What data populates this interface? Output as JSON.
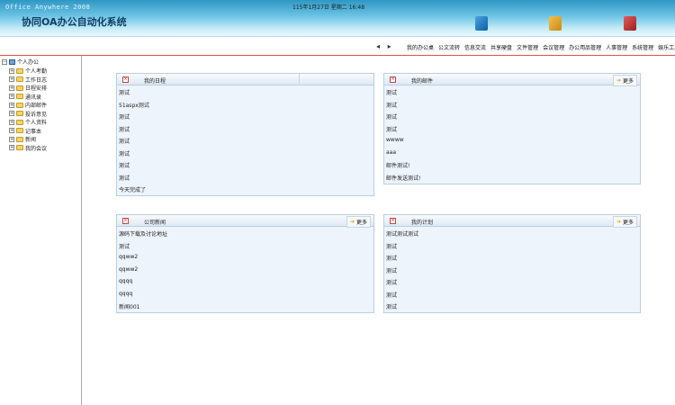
{
  "header": {
    "brand_en": "Office Anywhere 2008",
    "brand_cn": "协同OA办公自动化系统",
    "datetime": "115年1月27日 星期二 16:48"
  },
  "nav": {
    "arrow_left": "◂",
    "arrow_right": "▸",
    "items": [
      "我的办公桌",
      "公文流转",
      "信息交流",
      "共享硬盘",
      "文件管理",
      "会议管理",
      "办公用品管理",
      "人事管理",
      "系统管理",
      "娱乐工具"
    ]
  },
  "sidebar": {
    "root": "个人办公",
    "items": [
      "个人考勤",
      "工作日志",
      "日程安排",
      "通讯录",
      "内部邮件",
      "投诉意见",
      "个人资料",
      "记事本",
      "新闻",
      "我的会议"
    ]
  },
  "panels": {
    "schedule": {
      "title": "我的日程",
      "rows": [
        "测试",
        "51aspx测试",
        "测试",
        "测试",
        "测试",
        "测试",
        "测试",
        "测试",
        "今天完成了"
      ]
    },
    "mail": {
      "title": "我的邮件",
      "more": "更多",
      "rows": [
        "测试",
        "测试",
        "测试",
        "测试",
        "wwww",
        "aaa",
        "邮件测试!",
        "邮件发送测试!"
      ]
    },
    "news": {
      "title": "公司新闻",
      "more": "更多",
      "rows": [
        "源码下载及讨论地址",
        "测试",
        "qqww2",
        "qqww2",
        "qqqq",
        "qqqq",
        "新闻001"
      ]
    },
    "plan": {
      "title": "我的计划",
      "more": "更多",
      "rows": [
        "测试测试测试",
        "测试",
        "测试",
        "测试",
        "测试",
        "测试",
        "测试"
      ]
    }
  }
}
